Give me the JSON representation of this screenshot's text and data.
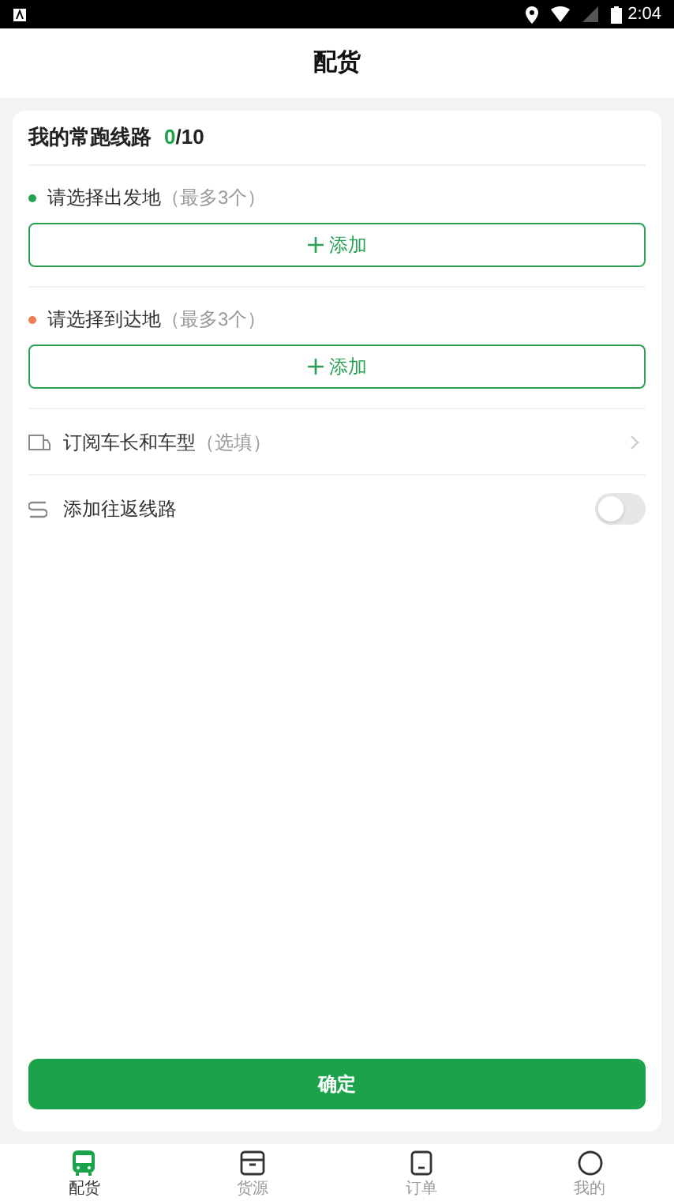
{
  "status_bar": {
    "time": "2:04"
  },
  "header": {
    "title": "配货"
  },
  "routes": {
    "title": "我的常跑线路",
    "count": "0",
    "total": "/10"
  },
  "pickers": [
    {
      "label": "请选择出发地",
      "hint": "（最多3个）",
      "color": "#22a350",
      "button": "添加"
    },
    {
      "label": "请选择到达地",
      "hint": "（最多3个）",
      "color": "#f07c4f",
      "button": "添加"
    }
  ],
  "options": [
    {
      "kind": "link",
      "label": "订阅车长和车型",
      "hint": "（选填）"
    },
    {
      "kind": "toggle",
      "label": "添加往返线路",
      "on": false
    }
  ],
  "confirm": "确定",
  "tabs": [
    {
      "label": "配货",
      "selected": true
    },
    {
      "label": "货源",
      "selected": false
    },
    {
      "label": "订单",
      "selected": false
    },
    {
      "label": "我的",
      "selected": false
    }
  ]
}
